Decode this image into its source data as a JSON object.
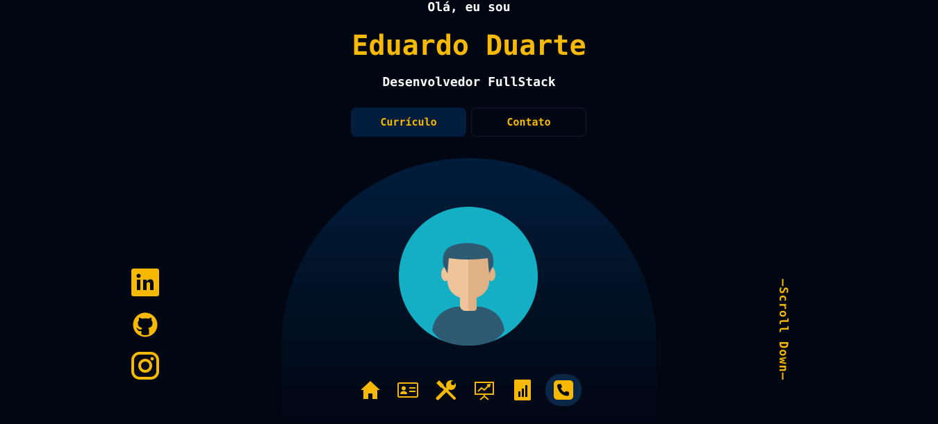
{
  "hero": {
    "greeting": "Olá, eu sou",
    "name": "Eduardo Duarte",
    "role": "Desenvolvedor FullStack"
  },
  "buttons": {
    "resume_label": "Currículo",
    "contact_label": "Contato"
  },
  "scroll": {
    "label": "—Scroll Down—"
  },
  "socials": [
    {
      "icon": "linkedin-icon"
    },
    {
      "icon": "github-icon"
    },
    {
      "icon": "instagram-icon"
    }
  ],
  "nav": {
    "items": [
      {
        "icon": "home-icon",
        "active": false
      },
      {
        "icon": "id-card-icon",
        "active": false
      },
      {
        "icon": "tools-icon",
        "active": false
      },
      {
        "icon": "presentation-icon",
        "active": false
      },
      {
        "icon": "bar-chart-icon",
        "active": false
      },
      {
        "icon": "phone-icon",
        "active": true
      }
    ]
  },
  "colors": {
    "background": "#010613",
    "accent": "#f6b900",
    "navy": "#001d3d",
    "text": "#ffffff",
    "avatar_bg": "#14afc4"
  }
}
